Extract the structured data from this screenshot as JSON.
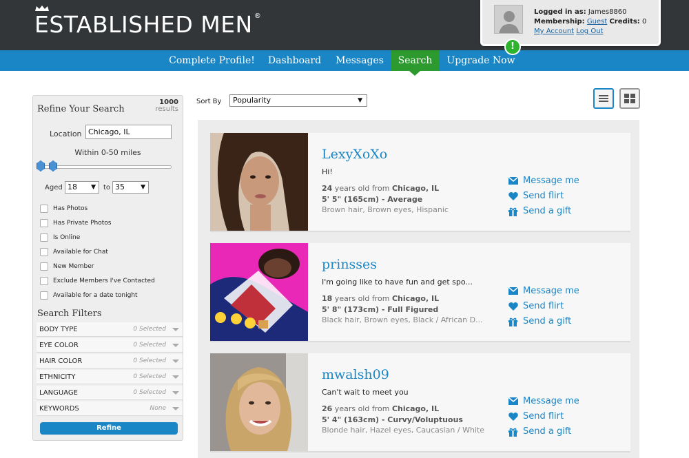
{
  "brand": {
    "name": "ESTABLISHED MEN",
    "reg": "®"
  },
  "account": {
    "logged_in_label": "Logged in as:",
    "username": "James8860",
    "membership_label": "Membership:",
    "membership": "Guest",
    "credits_label": "Credits:",
    "credits": "0",
    "my_account": "My Account",
    "logout": "Log Out",
    "alert": "!"
  },
  "nav": {
    "items": [
      {
        "label": "Complete Profile!"
      },
      {
        "label": "Dashboard"
      },
      {
        "label": "Messages"
      },
      {
        "label": "Search"
      },
      {
        "label": "Upgrade Now"
      }
    ],
    "active": "Search"
  },
  "sidebar": {
    "title": "Refine Your Search",
    "count": "1000",
    "count_label": "results",
    "location_label": "Location",
    "location_value": "Chicago, IL",
    "within": "Within 0-50 miles",
    "aged_label": "Aged",
    "age_min": "18",
    "to_label": "to",
    "age_max": "35",
    "checkboxes": [
      "Has Photos",
      "Has Private Photos",
      "Is Online",
      "Available for Chat",
      "New Member",
      "Exclude Members I've Contacted",
      "Available for a date tonight"
    ],
    "filters_title": "Search Filters",
    "filters": [
      {
        "name": "BODY TYPE",
        "value": "0 Selected"
      },
      {
        "name": "EYE COLOR",
        "value": "0 Selected"
      },
      {
        "name": "HAIR COLOR",
        "value": "0 Selected"
      },
      {
        "name": "ETHNICITY",
        "value": "0 Selected"
      },
      {
        "name": "LANGUAGE",
        "value": "0 Selected"
      },
      {
        "name": "KEYWORDS",
        "value": "None"
      }
    ],
    "refine": "Refine"
  },
  "main": {
    "sort_label": "Sort By",
    "sort_value": "Popularity"
  },
  "actions": {
    "message": "Message me",
    "flirt": "Send flirt",
    "gift": "Send a gift"
  },
  "profiles": [
    {
      "name": "LexyXoXo",
      "tagline": "Hi!",
      "age": "24",
      "age_text": " years old from ",
      "city": "Chicago, IL",
      "height": "5' 5\" (165cm) - Average",
      "desc": "Brown hair, Brown eyes, Hispanic"
    },
    {
      "name": "prinsses",
      "tagline": "I'm going like to have fun and get spo...",
      "age": "18",
      "age_text": " years old from ",
      "city": "Chicago, IL",
      "height": "5' 8\" (173cm) - Full Figured",
      "desc": "Black hair, Brown eyes, Black / African D..."
    },
    {
      "name": "mwalsh09",
      "tagline": "Can't wait to meet you",
      "age": "26",
      "age_text": " years old from ",
      "city": "Chicago, IL",
      "height": "5' 4\" (163cm) - Curvy/Voluptuous",
      "desc": "Blonde hair, Hazel eyes, Caucasian / White"
    }
  ],
  "colors": {
    "header_bg": "#323639",
    "nav_bg": "#1b86c6",
    "nav_active": "#2c9a2e",
    "link": "#1b86c6"
  }
}
